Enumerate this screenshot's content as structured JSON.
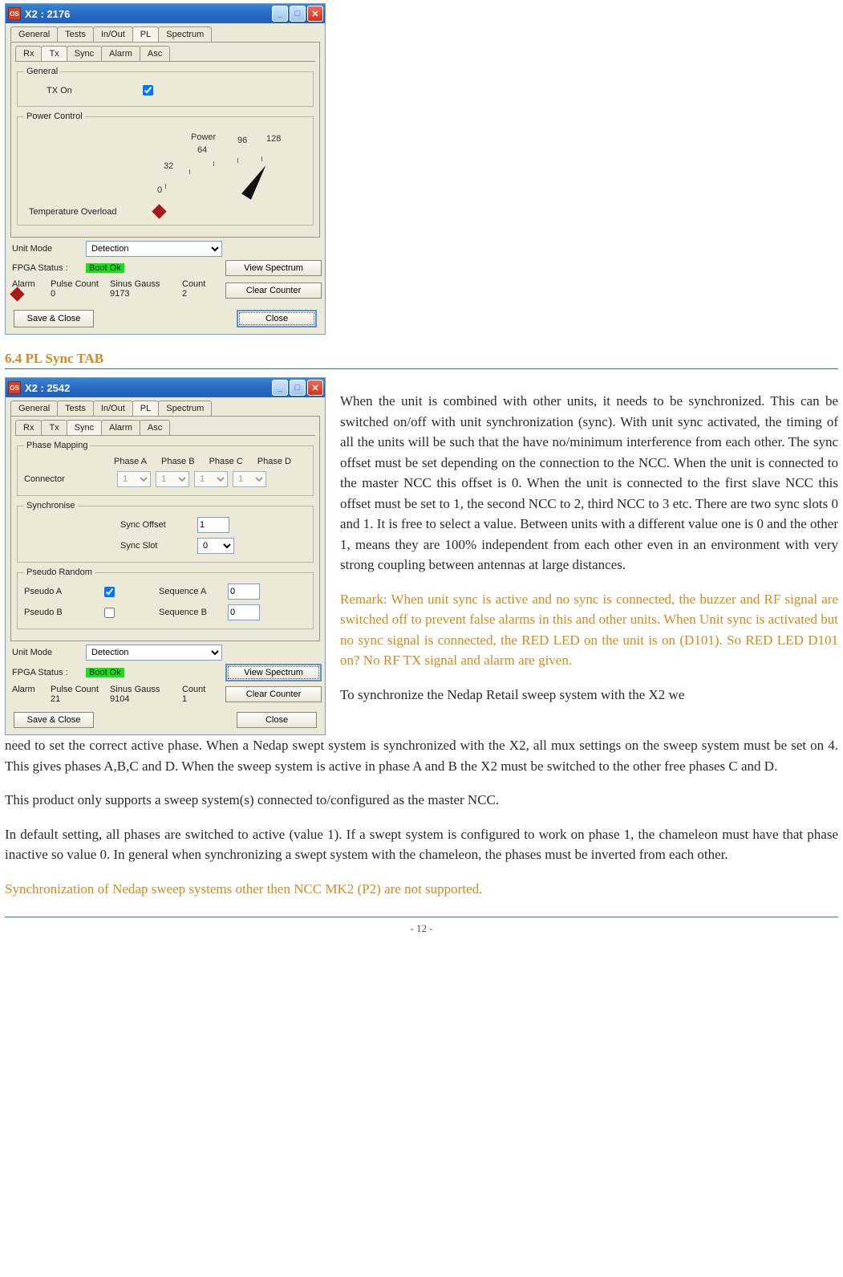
{
  "win1": {
    "title": "X2 : 2176",
    "tabs_top": [
      "General",
      "Tests",
      "In/Out",
      "PL",
      "Spectrum"
    ],
    "tabs_top_active": 3,
    "tabs_sub": [
      "Rx",
      "Tx",
      "Sync",
      "Alarm",
      "Asc"
    ],
    "tabs_sub_active": 1,
    "general_group": "General",
    "tx_on_label": "TX On",
    "tx_on_checked": true,
    "power_group": "Power Control",
    "power_label": "Power",
    "power_ticks": [
      "0",
      "32",
      "64",
      "96",
      "128"
    ],
    "temp_label": "Temperature Overload",
    "unit_mode_label": "Unit Mode",
    "unit_mode_value": "Detection",
    "fpga_label": "FPGA Status :",
    "fpga_value": "Boot Ok",
    "stat_headers": [
      "Alarm",
      "Pulse Count",
      "Sinus Gauss",
      "Count"
    ],
    "stat_values": [
      "",
      "0",
      "9173",
      "2"
    ],
    "btn_view": "View Spectrum",
    "btn_clear": "Clear Counter",
    "btn_save": "Save & Close",
    "btn_close": "Close"
  },
  "heading": "6.4 PL Sync TAB",
  "win2": {
    "title": "X2 : 2542",
    "tabs_top": [
      "General",
      "Tests",
      "In/Out",
      "PL",
      "Spectrum"
    ],
    "tabs_top_active": 3,
    "tabs_sub": [
      "Rx",
      "Tx",
      "Sync",
      "Alarm",
      "Asc"
    ],
    "tabs_sub_active": 2,
    "phase_group": "Phase Mapping",
    "phase_headers": [
      "Phase A",
      "Phase B",
      "Phase C",
      "Phase D"
    ],
    "connector_label": "Connector",
    "phase_values": [
      "1",
      "1",
      "1",
      "1"
    ],
    "sync_group": "Synchronise",
    "sync_offset_label": "Sync Offset",
    "sync_offset_value": "1",
    "sync_slot_label": "Sync Slot",
    "sync_slot_value": "0",
    "pseudo_group": "Pseudo Random",
    "pseudo_a_label": "Pseudo A",
    "pseudo_a_checked": true,
    "seq_a_label": "Sequence A",
    "seq_a_value": "0",
    "pseudo_b_label": "Pseudo B",
    "pseudo_b_checked": false,
    "seq_b_label": "Sequence B",
    "seq_b_value": "0",
    "unit_mode_label": "Unit Mode",
    "unit_mode_value": "Detection",
    "fpga_label": "FPGA Status :",
    "fpga_value": "Boot Ok",
    "stat_headers": [
      "Alarm",
      "Pulse Count",
      "Sinus Gauss",
      "Count"
    ],
    "stat_values": [
      "",
      "21",
      "9104",
      "1"
    ],
    "btn_view": "View Spectrum",
    "btn_clear": "Clear Counter",
    "btn_save": "Save & Close",
    "btn_close": "Close"
  },
  "para1": "When the unit is combined with other units, it needs to be synchronized. This can be switched on/off with unit synchronization (sync). With unit sync activated, the timing of all the units will be such that the have no/minimum interference from each other. The sync offset must be set depending on the connection to the NCC. When the unit is connected to the master NCC this offset is 0. When the unit is connected to the first slave NCC this offset must be set to 1, the second NCC to 2, third NCC to 3 etc. There are two sync slots 0 and 1. It is free to select a value. Between units with a different value one is 0 and the other 1, means they are 100% independent from each other even in an environment with very strong coupling between antennas at large distances.",
  "remark": "Remark: When unit sync is active and no sync is connected, the buzzer and RF signal are switched off to prevent false alarms in this and other units. When Unit sync is activated but no sync signal is connected, the RED LED on the unit is on (D101).  So RED LED D101 on? No RF TX signal and alarm are given.",
  "para2_lead": "To synchronize the Nedap Retail sweep system with the X2 we",
  "para2_rest": "need to set the correct active phase. When a Nedap swept system is synchronized with the X2, all mux settings on the sweep system must be set on 4. This gives phases A,B,C and D.  When the sweep system is active in phase A and B the X2 must be switched to the other free phases C and D.",
  "para3": "This product only supports a sweep system(s) connected to/configured as the master NCC.",
  "para4": "In default setting, all phases are switched to active (value 1). If a swept system is configured to work on phase 1, the chameleon must have that phase inactive so value 0. In general when synchronizing a swept system with the chameleon, the phases must be inverted from each other.",
  "para5": "Synchronization of Nedap sweep systems other then NCC MK2 (P2) are not supported.",
  "pagenum": "- 12 -"
}
